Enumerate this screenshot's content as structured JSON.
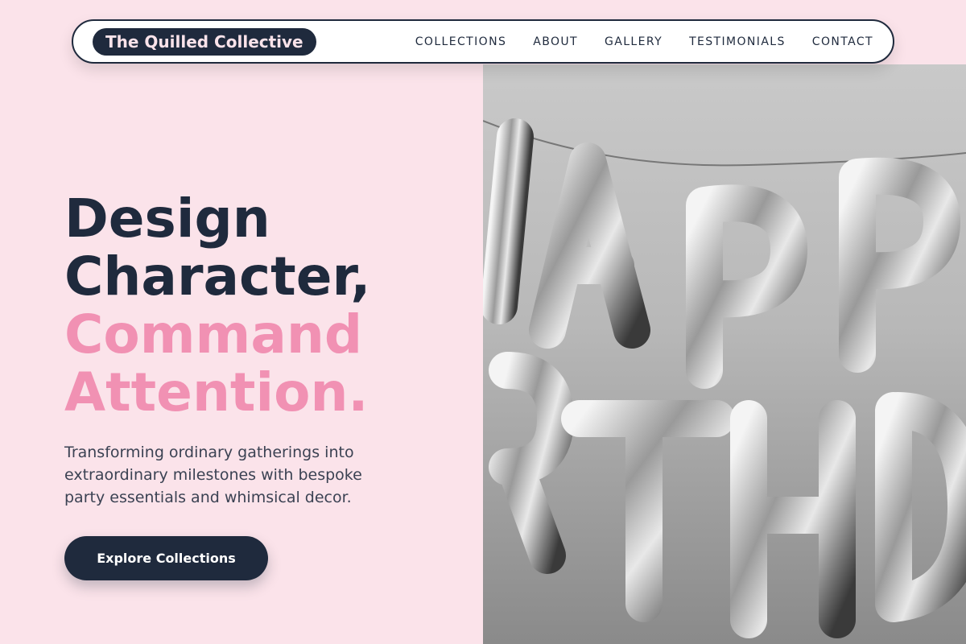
{
  "nav": {
    "brand": "The Quilled Collective",
    "links": [
      "COLLECTIONS",
      "ABOUT",
      "GALLERY",
      "TESTIMONIALS",
      "CONTACT"
    ]
  },
  "hero": {
    "headline_dark": [
      "Design",
      "Character,"
    ],
    "headline_pink": [
      "Command",
      "Attention."
    ],
    "subtitle": "Transforming ordinary gatherings into extraordinary milestones with bespoke party essentials and whimsical decor.",
    "cta_label": "Explore Collections",
    "image_icon": "birthday-balloons-image"
  },
  "colors": {
    "background": "#fbe3ea",
    "navy": "#1f2a3d",
    "pink_accent": "#f191b3"
  }
}
